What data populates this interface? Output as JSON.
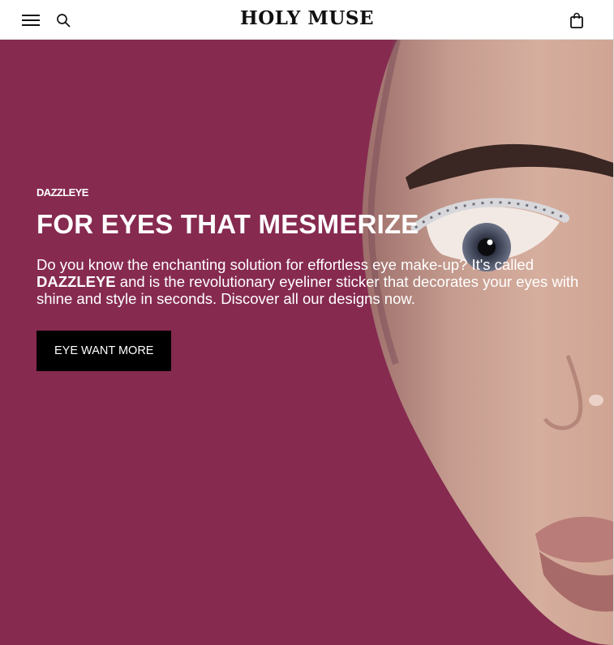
{
  "header": {
    "logo": "HOLY MUSE",
    "icons": {
      "menu": "hamburger-menu-icon",
      "search": "search-icon",
      "cart": "shopping-bag-icon"
    }
  },
  "hero": {
    "eyebrow": "DAZZLEYE",
    "headline": "FOR EYES THAT MESMERIZE",
    "body_pre": "Do you know the enchanting solution for effortless eye make-up? It's called ",
    "body_bold": "DAZZLEYE",
    "body_post": " and is the revolutionary eyeliner sticker that decorates your eyes with shine and style in seconds. Discover all our designs now.",
    "cta_label": "EYE WANT MORE",
    "background_color": "#862a50"
  }
}
